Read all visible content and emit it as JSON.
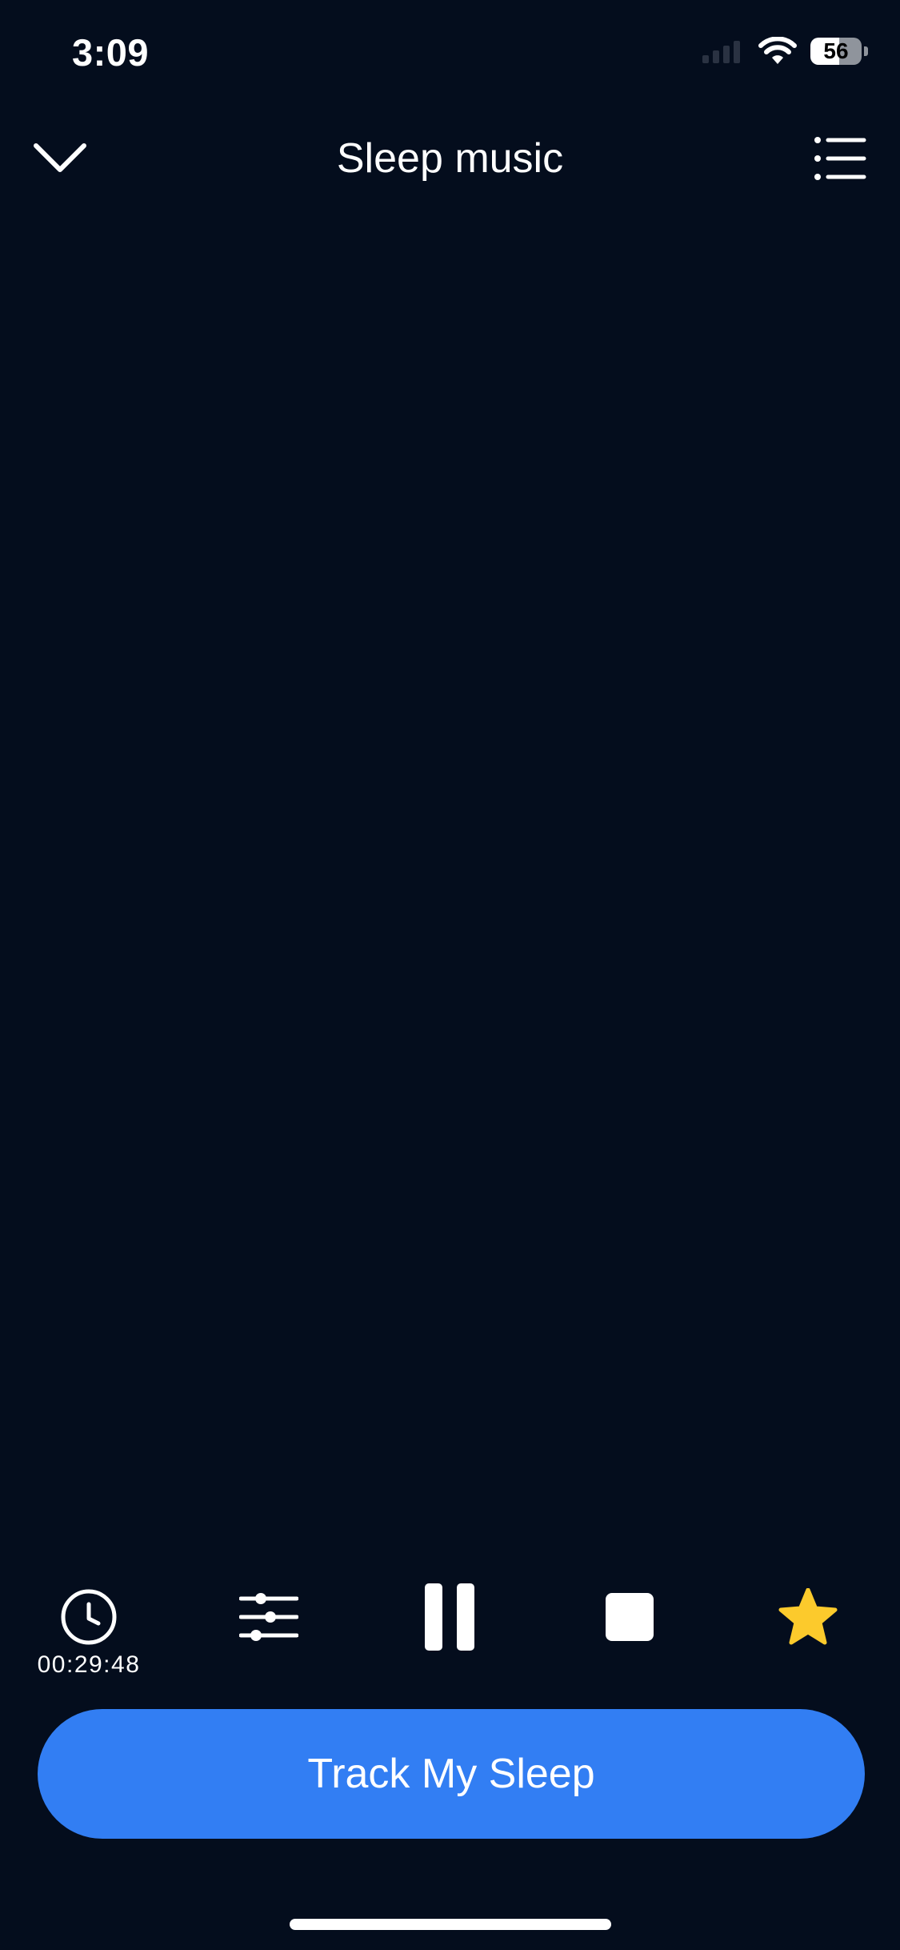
{
  "status_bar": {
    "time": "3:09",
    "battery_level": "56",
    "battery_fraction": 0.56
  },
  "header": {
    "title": "Sleep music",
    "back_icon": "chevron-down-icon",
    "menu_icon": "playlist-icon"
  },
  "controls": {
    "timer_value": "00:29:48",
    "timer_icon": "clock-icon",
    "mixer_icon": "sliders-icon",
    "pause_icon": "pause-icon",
    "stop_icon": "stop-icon",
    "favorite_icon": "star-icon"
  },
  "cta": {
    "label": "Track My Sleep"
  },
  "colors": {
    "background": "#040d1d",
    "accent": "#327ef3",
    "favorite": "#fcca2c",
    "text": "#ffffff"
  }
}
